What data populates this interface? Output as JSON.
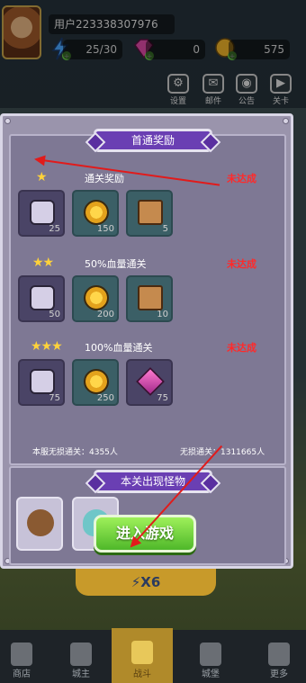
{
  "hud": {
    "user_id": "用户223338307976",
    "energy": "25/30",
    "gems": "0",
    "coins": "575",
    "buttons": [
      {
        "label": "设置",
        "icon": "gear-icon"
      },
      {
        "label": "邮件",
        "icon": "mail-icon"
      },
      {
        "label": "公告",
        "icon": "megaphone-icon"
      },
      {
        "label": "关卡",
        "icon": "play-icon"
      }
    ]
  },
  "modal": {
    "rewards_title": "首通奖励",
    "tiers": [
      {
        "stars": "★",
        "title": "通关奖励",
        "status": "未达成",
        "items": [
          {
            "icon": "puzzle-icon",
            "qty": "25"
          },
          {
            "icon": "coin-icon",
            "qty": "150"
          },
          {
            "icon": "scroll-icon",
            "qty": "5"
          }
        ]
      },
      {
        "stars": "★★",
        "title": "50%血量通关",
        "status": "未达成",
        "items": [
          {
            "icon": "puzzle-icon",
            "qty": "50"
          },
          {
            "icon": "coin-icon",
            "qty": "200"
          },
          {
            "icon": "scroll-icon",
            "qty": "10"
          }
        ]
      },
      {
        "stars": "★★★",
        "title": "100%血量通关",
        "status": "未达成",
        "items": [
          {
            "icon": "puzzle-icon",
            "qty": "75"
          },
          {
            "icon": "coin-icon",
            "qty": "250"
          },
          {
            "icon": "gem-icon",
            "qty": "75"
          }
        ]
      }
    ],
    "stat_left": "本服无损通关：4355人",
    "stat_right": "无损通关：1311665人",
    "monsters_title": "本关出现怪物",
    "enter_label": "进入游戏",
    "multiplier_label": "X6"
  },
  "nav": {
    "items": [
      {
        "label": "商店"
      },
      {
        "label": "城主"
      },
      {
        "label": "战斗"
      },
      {
        "label": "城堡"
      },
      {
        "label": "更多"
      }
    ]
  },
  "colors": {
    "modal_bg": "#9a94ac",
    "banner": "#6a3fb3",
    "status_red": "#ff2a2a",
    "enter_green": "#4fb82a",
    "arrow_red": "#e11b1b"
  }
}
